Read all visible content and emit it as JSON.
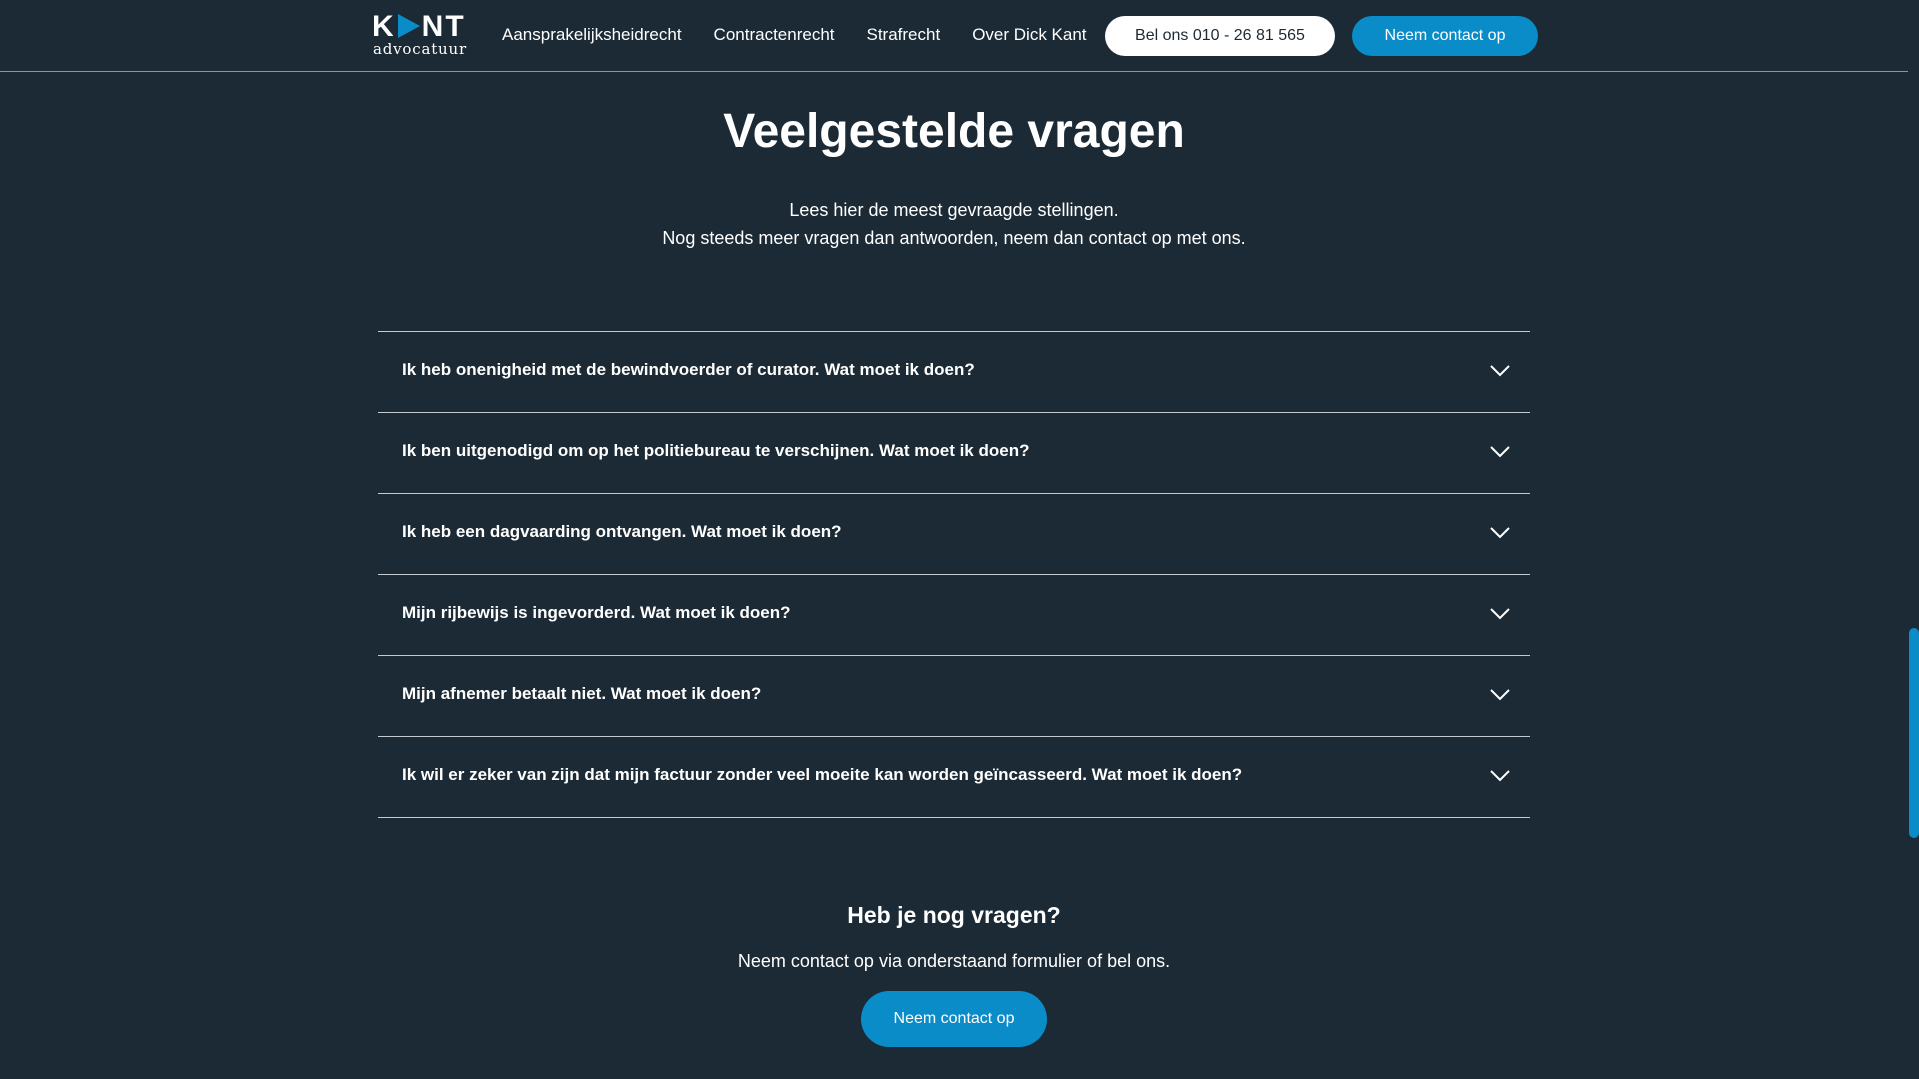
{
  "header": {
    "logo_top_left": "K",
    "logo_top_right": "NT",
    "logo_bottom": "advocatuur",
    "nav": [
      {
        "label": "Aansprakelijksheidrecht"
      },
      {
        "label": "Contractenrecht"
      },
      {
        "label": "Strafrecht"
      },
      {
        "label": "Over Dick Kant"
      }
    ],
    "call_button": "Bel ons 010 - 26 81 565",
    "contact_button": "Neem contact op"
  },
  "main": {
    "title": "Veelgestelde vragen",
    "intro_line1": "Lees hier de meest gevraagde stellingen.",
    "intro_line2": "Nog steeds meer vragen dan antwoorden, neem dan contact op met ons.",
    "faq": [
      {
        "question": "Ik heb onenigheid met de bewindvoerder of curator. Wat moet ik doen?"
      },
      {
        "question": "Ik ben uitgenodigd om op het politiebureau te verschijnen. Wat moet ik doen?"
      },
      {
        "question": "Ik heb een dagvaarding ontvangen. Wat moet ik doen?"
      },
      {
        "question": "Mijn rijbewijs is ingevorderd. Wat moet ik doen?"
      },
      {
        "question": "Mijn afnemer betaalt niet. Wat moet ik doen?"
      },
      {
        "question": "Ik wil er zeker van zijn dat mijn factuur zonder veel moeite kan worden geïncasseerd. Wat moet ik doen?"
      }
    ]
  },
  "cta": {
    "title": "Heb je nog vragen?",
    "text": "Neem contact op via onderstaand formulier of bel ons.",
    "button": "Neem contact op"
  },
  "colors": {
    "background": "#1b2a35",
    "accent": "#0a8cc8",
    "text": "#ffffff"
  },
  "icons": {
    "chevron": "chevron-down-icon",
    "logo_mark": "triangle-play-icon"
  }
}
